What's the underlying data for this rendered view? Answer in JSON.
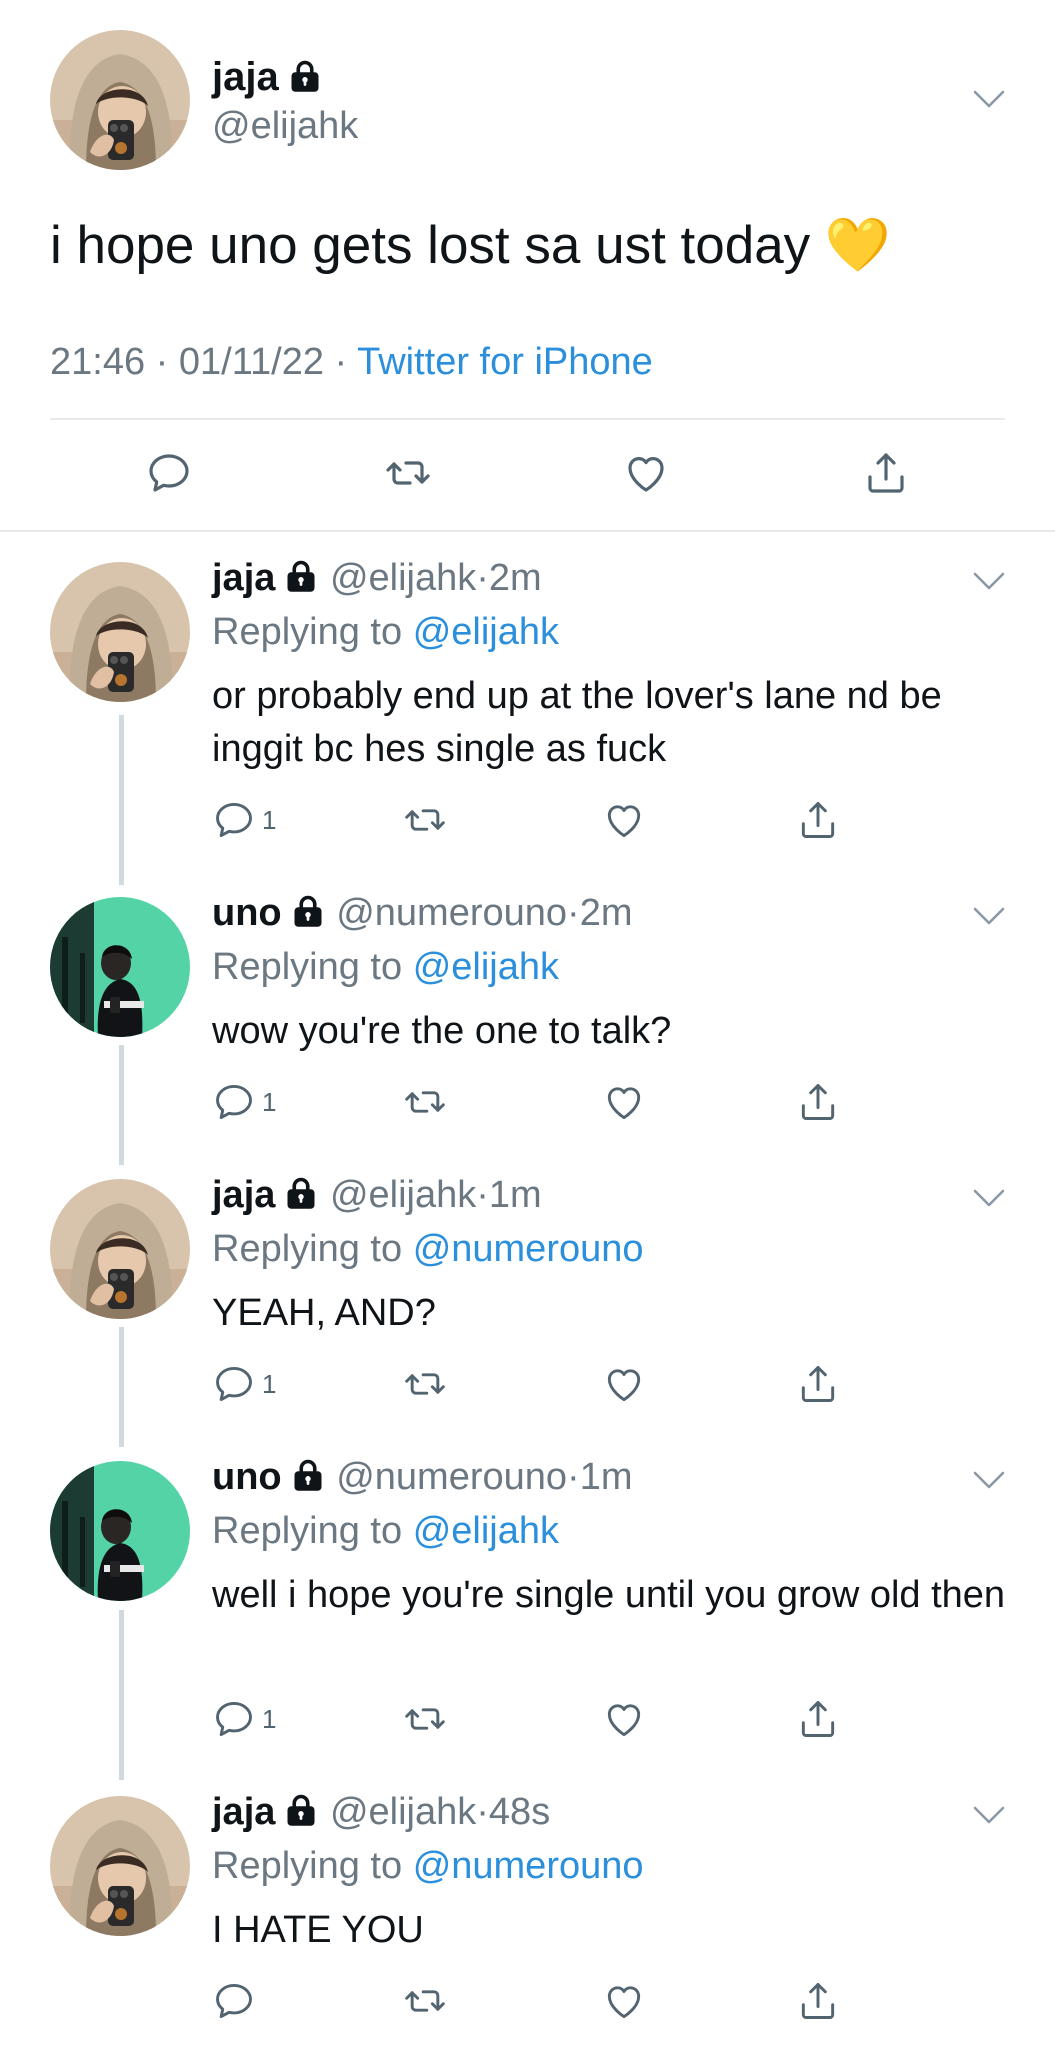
{
  "main_tweet": {
    "name": "jaja",
    "handle": "@elijahk",
    "text": "i hope uno gets lost sa ust today 💛",
    "time": "21:46",
    "date": "01/11/22",
    "source": "Twitter for iPhone"
  },
  "labels": {
    "replying_to": "Replying to",
    "dot": "·"
  },
  "replies": [
    {
      "name": "jaja",
      "handle": "@elijahk",
      "age": "2m",
      "reply_to": "@elijahk",
      "text": "or probably end up at the lover's lane nd be inggit bc hes single as fuck",
      "reply_count": "1"
    },
    {
      "name": "uno",
      "handle": "@numerouno",
      "age": "2m",
      "reply_to": "@elijahk",
      "text": "wow you're the one to talk?",
      "reply_count": "1"
    },
    {
      "name": "jaja",
      "handle": "@elijahk",
      "age": "1m",
      "reply_to": "@numerouno",
      "text": "YEAH, AND?",
      "reply_count": "1"
    },
    {
      "name": "uno",
      "handle": "@numerouno",
      "age": "1m",
      "reply_to": "@elijahk",
      "text": "well i hope you're single until you grow old then",
      "reply_count": "1"
    },
    {
      "name": "jaja",
      "handle": "@elijahk",
      "age": "48s",
      "reply_to": "@numerouno",
      "text": "I HATE YOU",
      "reply_count": ""
    }
  ],
  "icons": {
    "reply": "reply-bubble-icon",
    "retweet": "retweet-icon",
    "like": "heart-icon",
    "share": "share-icon",
    "lock": "lock-icon",
    "more": "chevron-down-icon"
  },
  "colors": {
    "link": "#2b8fdc",
    "muted": "#6b7781",
    "icon": "#536471",
    "thread_line": "#cfd9de"
  }
}
